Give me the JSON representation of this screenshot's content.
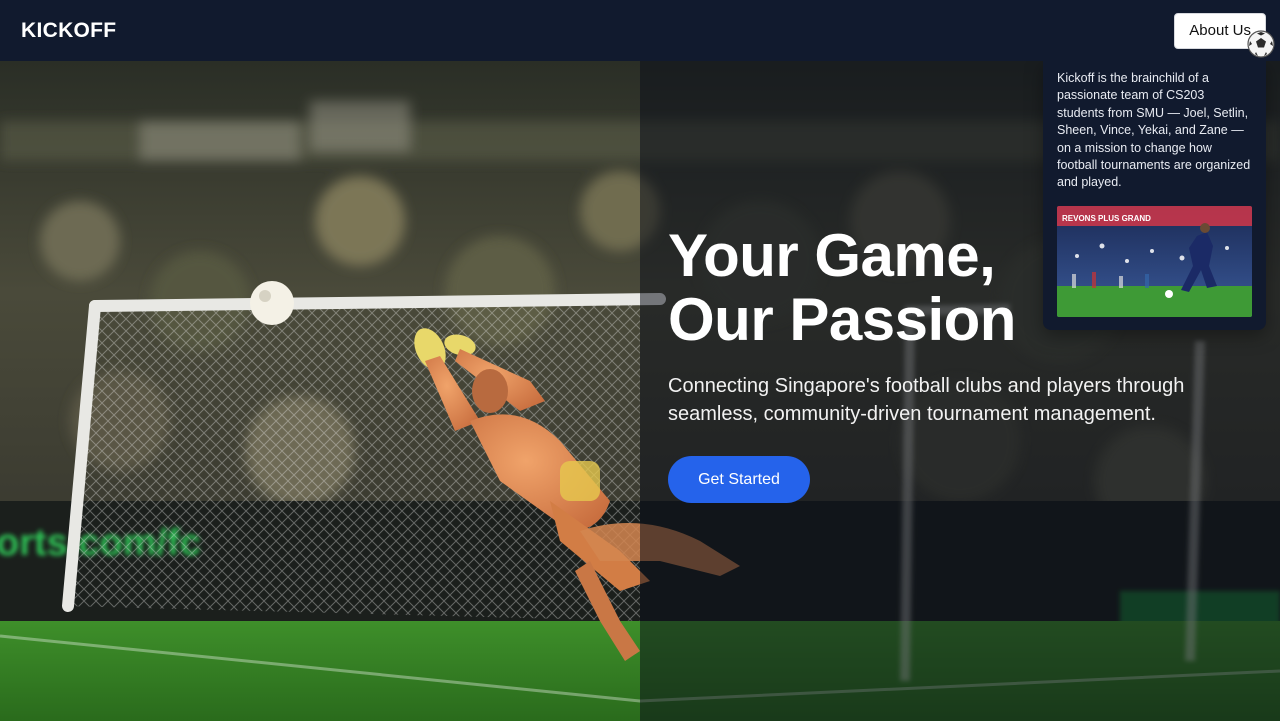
{
  "nav": {
    "brand": "KICKOFF",
    "about_label": "About Us"
  },
  "about_card": {
    "text": "Kickoff is the brainchild of a passionate team of CS203 students from SMU — Joel, Setlin, Sheen, Vince, Yekai, and Zane — on a mission to change how football tournaments are organized and played.",
    "image_banner": "REVONS PLUS GRAND"
  },
  "hero": {
    "headline_line1": "Your Game,",
    "headline_line2": "Our Passion",
    "subline": "Connecting Singapore's football clubs and players through seamless, community-driven tournament management.",
    "cta_label": "Get Started",
    "ad_board_text": "orts.com/fc"
  },
  "colors": {
    "nav_bg": "#111a2e",
    "accent": "#2563eb",
    "pitch_green": "#2f7d23"
  }
}
